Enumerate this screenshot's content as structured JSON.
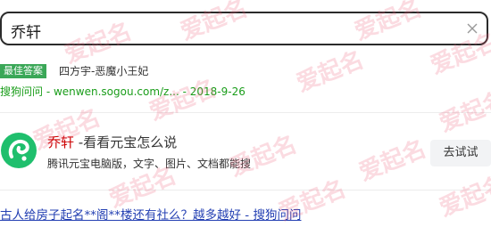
{
  "search": {
    "query": "乔轩"
  },
  "best_answer": {
    "badge": "最佳答案",
    "text": "四方宇-恶魔小王妃",
    "source_name": "搜狗问问",
    "source_url": "wenwen.sogou.com/z...",
    "separator": " - ",
    "date": "2018-9-26"
  },
  "card": {
    "title_keyword": "乔轩",
    "title_rest": " -看看元宝怎么说",
    "description": "腾讯元宝电脑版，文字、图片、文档都能搜",
    "button_label": "去试试"
  },
  "bottom_link": {
    "text": "古人给房子起名**阁**楼还有社么？越多越好 - 搜狗问问"
  },
  "watermark": {
    "text": "爱起名"
  },
  "colors": {
    "badge_bg": "#3aa757",
    "source_green": "#1a9d1a",
    "keyword_red": "#cc0000",
    "link_blue": "#2440b3",
    "watermark_pink": "#ec5c78"
  },
  "icons": {
    "clear": "close-icon",
    "card_logo": "yuanbao-logo-icon"
  }
}
